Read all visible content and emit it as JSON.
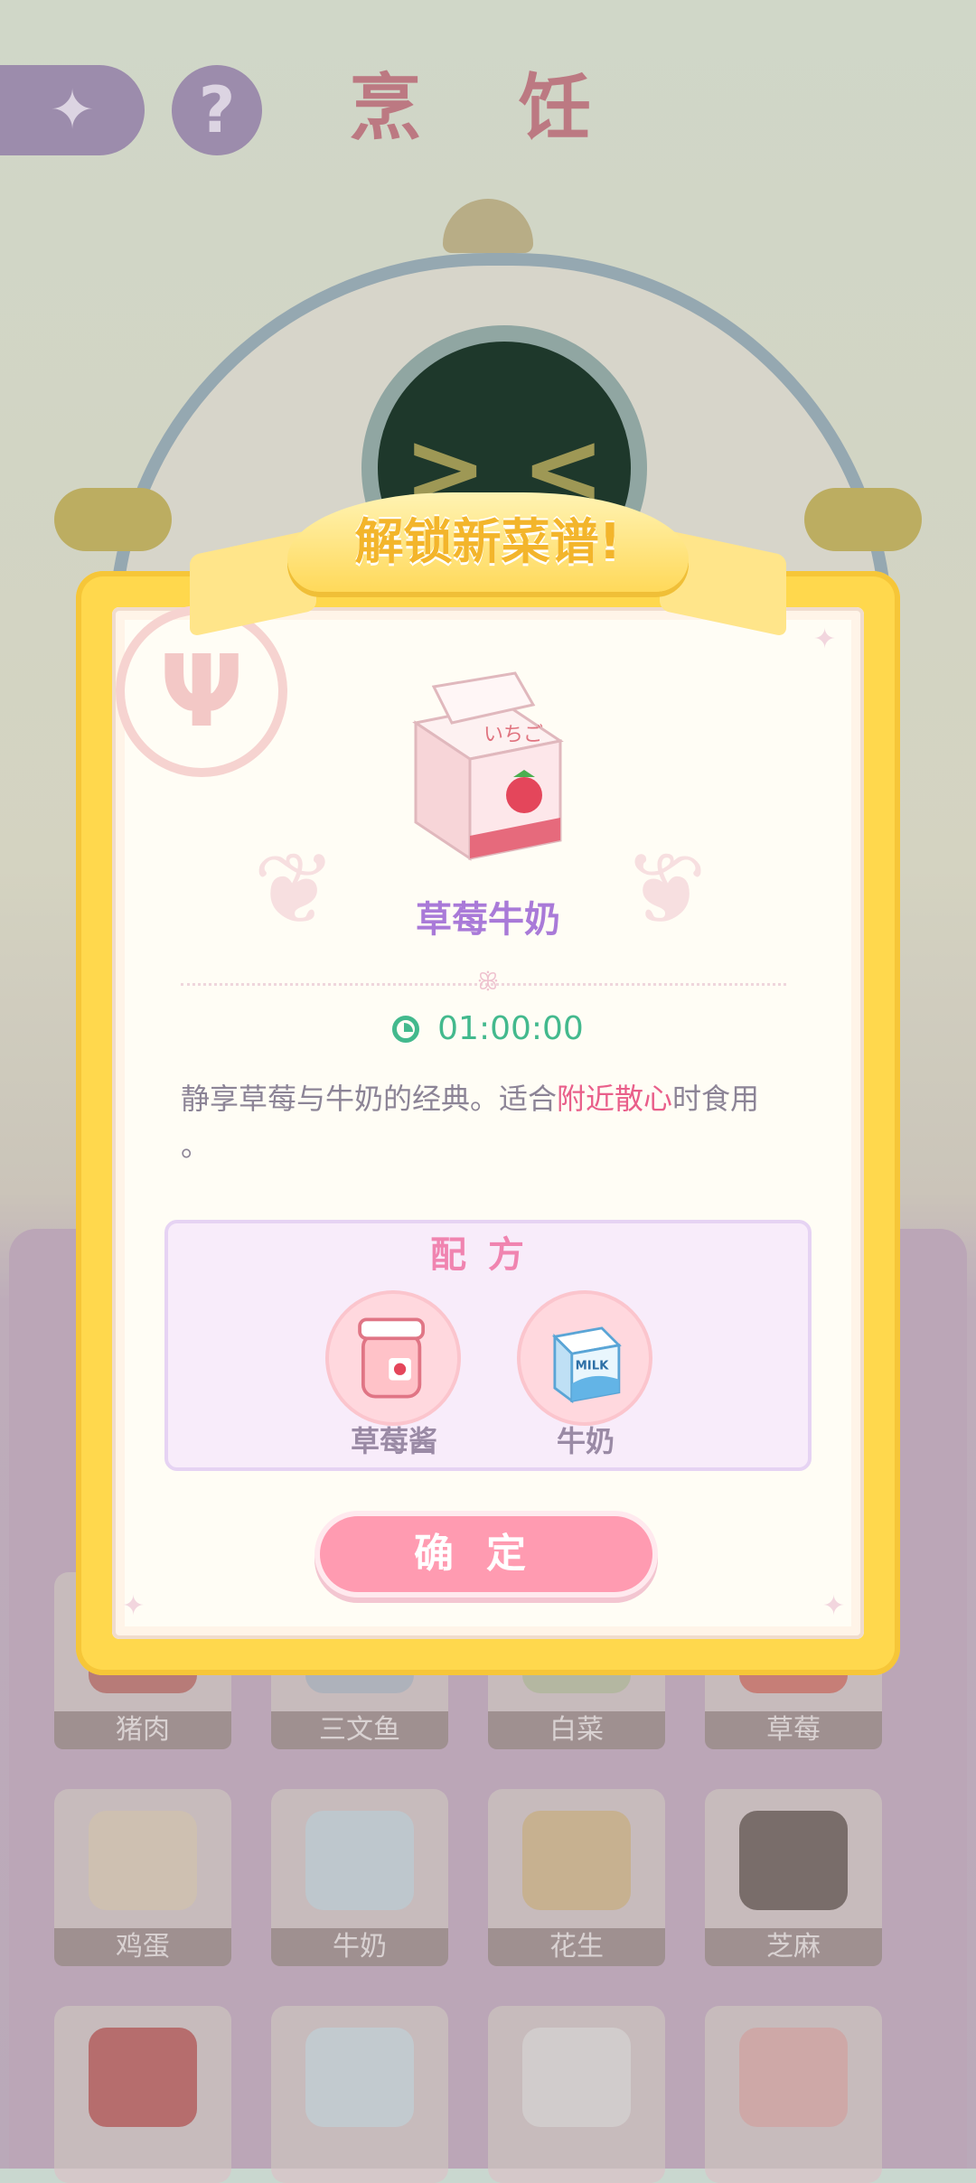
{
  "background": {
    "title": "烹 饪",
    "back_icon": "arrow-left-icon",
    "help_label": "?",
    "robot_face": "> <",
    "ingredients": [
      {
        "label": "猪肉"
      },
      {
        "label": "三文鱼"
      },
      {
        "label": "白菜"
      },
      {
        "label": "草莓"
      },
      {
        "label": "鸡蛋"
      },
      {
        "label": "牛奶"
      },
      {
        "label": "花生"
      },
      {
        "label": "芝麻"
      },
      {
        "label": ""
      },
      {
        "label": ""
      },
      {
        "label": ""
      },
      {
        "label": ""
      }
    ]
  },
  "modal": {
    "banner_title": "解锁新菜谱!",
    "recipe_name": "草莓牛奶",
    "carton_text": "いちご",
    "time": "01:00:00",
    "description_prefix": "静享草莓与牛奶的经典。适合",
    "description_highlight": "附近散心",
    "description_suffix": "时食用",
    "description_tail": "。",
    "formula_title": "配方",
    "formula": [
      {
        "name": "草莓酱",
        "icon": "strawberry-jam-icon"
      },
      {
        "name": "牛奶",
        "icon": "milk-carton-icon"
      }
    ],
    "confirm_label": "确定"
  },
  "colors": {
    "frame": "#ffd84d",
    "recipe_name": "#a97ad8",
    "timer": "#43b98d",
    "highlight": "#e95f8a",
    "confirm": "#ff9bb1"
  }
}
